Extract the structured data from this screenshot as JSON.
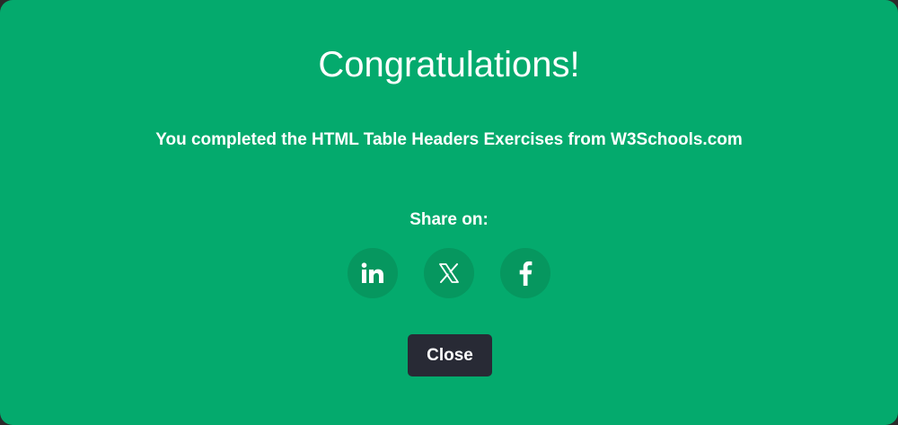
{
  "modal": {
    "title": "Congratulations!",
    "message": "You completed the HTML Table Headers Exercises from W3Schools.com",
    "share_label": "Share on:",
    "share_buttons": [
      {
        "icon": "linkedin-icon",
        "label": "in"
      },
      {
        "icon": "x-icon",
        "label": "𝕏"
      },
      {
        "icon": "facebook-icon",
        "label": "f"
      }
    ],
    "close_label": "Close"
  },
  "colors": {
    "background": "#04aa6d",
    "share_button": "#06975f",
    "close_button": "#282a35",
    "text": "#ffffff"
  }
}
